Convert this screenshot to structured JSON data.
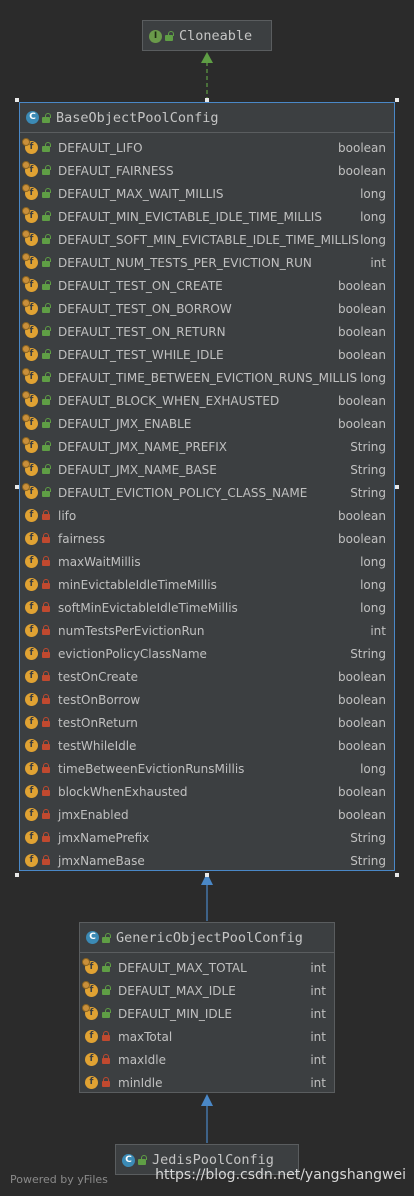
{
  "cloneable": {
    "name": "Cloneable",
    "icon": "interface-icon",
    "icon_letter": "I"
  },
  "base": {
    "name": "BaseObjectPoolConfig",
    "icon": "class-icon",
    "icon_letter": "C",
    "fields": [
      {
        "name": "DEFAULT_LIFO",
        "type": "boolean",
        "visibility": "public",
        "static": true
      },
      {
        "name": "DEFAULT_FAIRNESS",
        "type": "boolean",
        "visibility": "public",
        "static": true
      },
      {
        "name": "DEFAULT_MAX_WAIT_MILLIS",
        "type": "long",
        "visibility": "public",
        "static": true
      },
      {
        "name": "DEFAULT_MIN_EVICTABLE_IDLE_TIME_MILLIS",
        "type": "long",
        "visibility": "public",
        "static": true
      },
      {
        "name": "DEFAULT_SOFT_MIN_EVICTABLE_IDLE_TIME_MILLIS",
        "type": "long",
        "visibility": "public",
        "static": true
      },
      {
        "name": "DEFAULT_NUM_TESTS_PER_EVICTION_RUN",
        "type": "int",
        "visibility": "public",
        "static": true
      },
      {
        "name": "DEFAULT_TEST_ON_CREATE",
        "type": "boolean",
        "visibility": "public",
        "static": true
      },
      {
        "name": "DEFAULT_TEST_ON_BORROW",
        "type": "boolean",
        "visibility": "public",
        "static": true
      },
      {
        "name": "DEFAULT_TEST_ON_RETURN",
        "type": "boolean",
        "visibility": "public",
        "static": true
      },
      {
        "name": "DEFAULT_TEST_WHILE_IDLE",
        "type": "boolean",
        "visibility": "public",
        "static": true
      },
      {
        "name": "DEFAULT_TIME_BETWEEN_EVICTION_RUNS_MILLIS",
        "type": "long",
        "visibility": "public",
        "static": true
      },
      {
        "name": "DEFAULT_BLOCK_WHEN_EXHAUSTED",
        "type": "boolean",
        "visibility": "public",
        "static": true
      },
      {
        "name": "DEFAULT_JMX_ENABLE",
        "type": "boolean",
        "visibility": "public",
        "static": true
      },
      {
        "name": "DEFAULT_JMX_NAME_PREFIX",
        "type": "String",
        "visibility": "public",
        "static": true
      },
      {
        "name": "DEFAULT_JMX_NAME_BASE",
        "type": "String",
        "visibility": "public",
        "static": true
      },
      {
        "name": "DEFAULT_EVICTION_POLICY_CLASS_NAME",
        "type": "String",
        "visibility": "public",
        "static": true
      },
      {
        "name": "lifo",
        "type": "boolean",
        "visibility": "private",
        "static": false
      },
      {
        "name": "fairness",
        "type": "boolean",
        "visibility": "private",
        "static": false
      },
      {
        "name": "maxWaitMillis",
        "type": "long",
        "visibility": "private",
        "static": false
      },
      {
        "name": "minEvictableIdleTimeMillis",
        "type": "long",
        "visibility": "private",
        "static": false
      },
      {
        "name": "softMinEvictableIdleTimeMillis",
        "type": "long",
        "visibility": "private",
        "static": false
      },
      {
        "name": "numTestsPerEvictionRun",
        "type": "int",
        "visibility": "private",
        "static": false
      },
      {
        "name": "evictionPolicyClassName",
        "type": "String",
        "visibility": "private",
        "static": false
      },
      {
        "name": "testOnCreate",
        "type": "boolean",
        "visibility": "private",
        "static": false
      },
      {
        "name": "testOnBorrow",
        "type": "boolean",
        "visibility": "private",
        "static": false
      },
      {
        "name": "testOnReturn",
        "type": "boolean",
        "visibility": "private",
        "static": false
      },
      {
        "name": "testWhileIdle",
        "type": "boolean",
        "visibility": "private",
        "static": false
      },
      {
        "name": "timeBetweenEvictionRunsMillis",
        "type": "long",
        "visibility": "private",
        "static": false
      },
      {
        "name": "blockWhenExhausted",
        "type": "boolean",
        "visibility": "private",
        "static": false
      },
      {
        "name": "jmxEnabled",
        "type": "boolean",
        "visibility": "private",
        "static": false
      },
      {
        "name": "jmxNamePrefix",
        "type": "String",
        "visibility": "private",
        "static": false
      },
      {
        "name": "jmxNameBase",
        "type": "String",
        "visibility": "private",
        "static": false
      }
    ]
  },
  "generic": {
    "name": "GenericObjectPoolConfig",
    "icon": "class-icon",
    "icon_letter": "C",
    "fields": [
      {
        "name": "DEFAULT_MAX_TOTAL",
        "type": "int",
        "visibility": "public",
        "static": true
      },
      {
        "name": "DEFAULT_MAX_IDLE",
        "type": "int",
        "visibility": "public",
        "static": true
      },
      {
        "name": "DEFAULT_MIN_IDLE",
        "type": "int",
        "visibility": "public",
        "static": true
      },
      {
        "name": "maxTotal",
        "type": "int",
        "visibility": "private",
        "static": false
      },
      {
        "name": "maxIdle",
        "type": "int",
        "visibility": "private",
        "static": false
      },
      {
        "name": "minIdle",
        "type": "int",
        "visibility": "private",
        "static": false
      }
    ]
  },
  "jedis": {
    "name": "JedisPoolConfig",
    "icon": "class-icon",
    "icon_letter": "C"
  },
  "field_icon_letter": "f",
  "footer": "Powered by yFiles",
  "watermark": "https://blog.csdn.net/yangshangwei",
  "colors": {
    "background": "#2b2b2b",
    "node": "#3c3f41",
    "selection": "#4a88c7",
    "inherit_arrow": "#4a88c7",
    "implements_arrow": "#5f9e45",
    "public": "#5f9e45",
    "private": "#c0492f",
    "field_icon": "#e0a233",
    "class_icon": "#3b8ab5"
  }
}
